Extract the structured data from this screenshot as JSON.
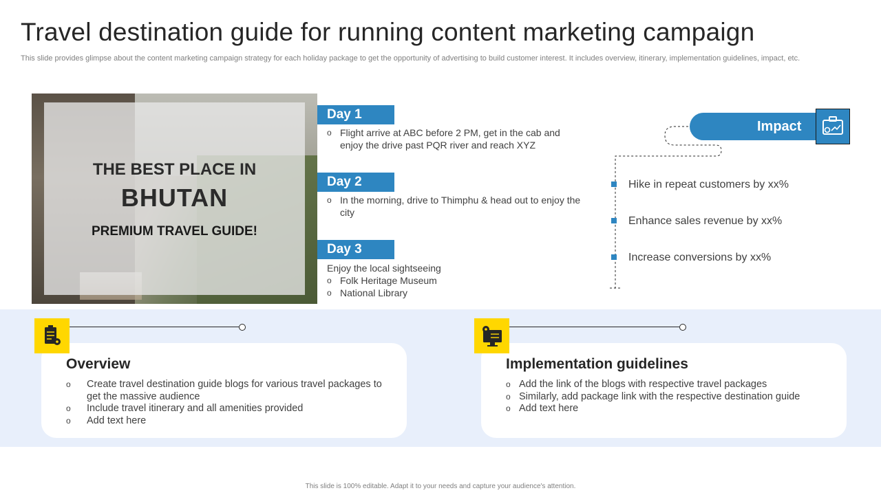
{
  "title": "Travel destination guide for running content marketing campaign",
  "subtitle": "This slide provides glimpse about the content marketing campaign strategy for each holiday package to get the opportunity of advertising to build customer interest. It includes overview, itinerary, implementation guidelines, impact, etc.",
  "hero": {
    "line1": "THE BEST PLACE IN",
    "line2": "BHUTAN",
    "line3": "PREMIUM TRAVEL GUIDE!"
  },
  "itinerary": [
    {
      "label": "Day 1",
      "intro": "",
      "points": [
        "Flight arrive at ABC before 2 PM, get in the cab and enjoy the drive past PQR river and reach XYZ"
      ]
    },
    {
      "label": "Day 2",
      "intro": "",
      "points": [
        "In the morning, drive to Thimphu & head out to enjoy the city"
      ]
    },
    {
      "label": "Day 3",
      "intro": "Enjoy the local sightseeing",
      "points": [
        "Folk Heritage Museum",
        "National Library"
      ]
    }
  ],
  "impact": {
    "label": "Impact",
    "items": [
      "Hike in repeat customers by xx%",
      "Enhance sales revenue by xx%",
      "Increase conversions by xx%"
    ]
  },
  "overview": {
    "title": "Overview",
    "points": [
      "Create travel destination guide blogs for various travel packages to get the massive audience",
      "Include travel itinerary and all amenities provided",
      "Add text here"
    ]
  },
  "implementation": {
    "title": "Implementation guidelines",
    "points": [
      "Add the link of the blogs with respective travel packages",
      "Similarly, add package link with the respective destination guide",
      "Add text here"
    ]
  },
  "colors": {
    "accent": "#2e86c1",
    "yellow": "#ffd700",
    "band": "#e8effb"
  },
  "footer": "This slide is 100% editable. Adapt it to your needs and capture your audience's attention."
}
